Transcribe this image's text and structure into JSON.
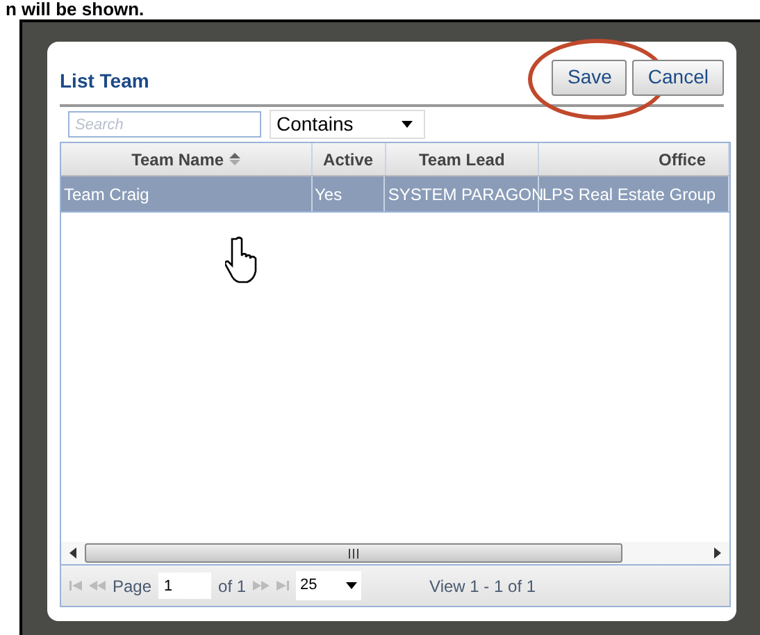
{
  "page_heading": "n will be shown.",
  "dialog": {
    "title": "List Team",
    "buttons": [
      {
        "label": "Save",
        "highlighted": true
      },
      {
        "label": "Cancel",
        "highlighted": false
      }
    ]
  },
  "search": {
    "placeholder": "Search"
  },
  "filter": {
    "value": "Contains"
  },
  "table": {
    "columns": [
      {
        "label": "Team Name",
        "sorted": true
      },
      {
        "label": "Active",
        "sorted": false
      },
      {
        "label": "Team Lead",
        "sorted": false
      },
      {
        "label": "Office",
        "sorted": false
      }
    ],
    "rows": [
      {
        "cells": [
          "Team Craig",
          "Yes",
          "SYSTEM PARAGON",
          "LPS Real Estate Group"
        ],
        "selected": true
      }
    ]
  },
  "pager": {
    "page_label": "Page",
    "page": "1",
    "of_label": "of 1",
    "page_size": "25",
    "view": "View 1 - 1 of 1"
  }
}
